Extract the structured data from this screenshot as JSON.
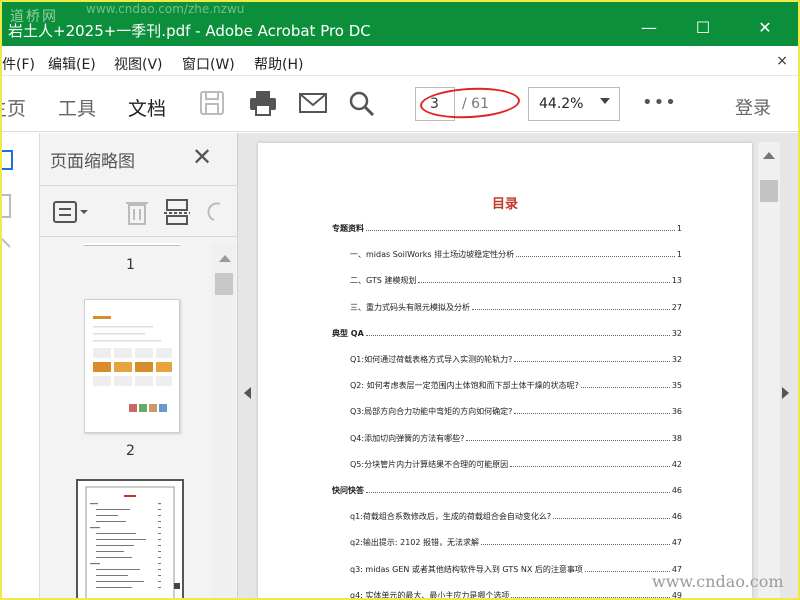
{
  "window": {
    "watermark_logo": "道桥网",
    "watermark_url_top": "www.cndao.com/zhe.nzwu",
    "title": "岩土人+2025+一季刊.pdf - Adobe Acrobat Pro DC",
    "minimize": "—",
    "maximize": "☐",
    "close": "✕"
  },
  "menubar": {
    "items": [
      "件(F)",
      "编辑(E)",
      "视图(V)",
      "窗口(W)",
      "帮助(H)"
    ],
    "close": "×"
  },
  "toolbar": {
    "tabs": [
      "主页",
      "工具",
      "文档"
    ],
    "active_tab": "文档",
    "current_page": "3",
    "total_pages": "/ 61",
    "zoom": "44.2%",
    "more": "•••",
    "login": "登录"
  },
  "thumbnail_panel": {
    "title": "页面缩略图",
    "close": "✕",
    "page_numbers": [
      "1",
      "2"
    ]
  },
  "document": {
    "toc_title": "目录",
    "entries": [
      {
        "label": "专题资料",
        "page": "1",
        "section": true
      },
      {
        "label": "一、midas SoilWorks 排土场边坡稳定性分析",
        "page": "1",
        "section": false
      },
      {
        "label": "二、GTS 建模规划",
        "page": "13",
        "section": false
      },
      {
        "label": "三、重力式码头有限元模拟及分析",
        "page": "27",
        "section": false
      },
      {
        "label": "典型 QA",
        "page": "32",
        "section": true
      },
      {
        "label": "Q1:如何通过荷载表格方式导入实测的轮轨力?",
        "page": "32",
        "section": false
      },
      {
        "label": "Q2: 如何考虑表层一定范围内土体饱和而下部土体干燥的状态呢?",
        "page": "35",
        "section": false
      },
      {
        "label": "Q3:局部方向合力功能中弯矩的方向如何确定?",
        "page": "36",
        "section": false
      },
      {
        "label": "Q4:添加切向弹簧的方法有哪些?",
        "page": "38",
        "section": false
      },
      {
        "label": "Q5:分块管片内力计算结果不合理的可能原因",
        "page": "42",
        "section": false
      },
      {
        "label": "快问快答",
        "page": "46",
        "section": true
      },
      {
        "label": "q1:荷载组合系数修改后，生成的荷载组合会自动变化么?",
        "page": "46",
        "section": false
      },
      {
        "label": "q2:输出提示: 2102 报错，无法求解",
        "page": "47",
        "section": false
      },
      {
        "label": "q3: midas GEN 或者其他结构软件导入到 GTS NX 后的注意事项",
        "page": "47",
        "section": false
      },
      {
        "label": "q4: 实体单元的最大、最小主应力是哪个选项",
        "page": "49",
        "section": false
      }
    ],
    "watermark": "www.cndao.com"
  },
  "colors": {
    "titlebar": "#0b8f3a",
    "annotation": "#e02424",
    "toc_title": "#c0392b",
    "frame_border": "#f0e94a"
  }
}
